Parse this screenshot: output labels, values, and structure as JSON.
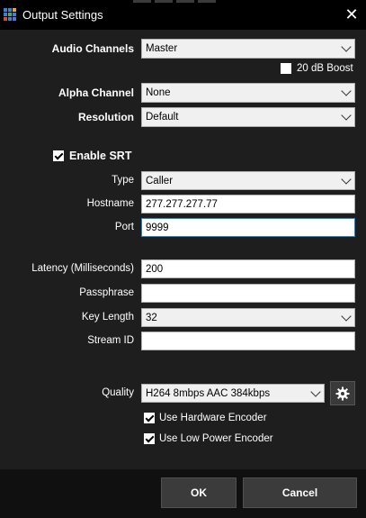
{
  "window": {
    "title": "Output Settings"
  },
  "audio": {
    "label": "Audio Channels",
    "value": "Master",
    "boost_label": "20 dB Boost",
    "boost_checked": false
  },
  "alpha": {
    "label": "Alpha Channel",
    "value": "None"
  },
  "resolution": {
    "label": "Resolution",
    "value": "Default"
  },
  "srt": {
    "enable_label": "Enable SRT",
    "enabled": true,
    "type_label": "Type",
    "type_value": "Caller",
    "hostname_label": "Hostname",
    "hostname_value": "277.277.277.77",
    "port_label": "Port",
    "port_value": "9999",
    "latency_label": "Latency (Milliseconds)",
    "latency_value": "200",
    "passphrase_label": "Passphrase",
    "passphrase_value": "",
    "keylength_label": "Key Length",
    "keylength_value": "32",
    "streamid_label": "Stream ID",
    "streamid_value": ""
  },
  "quality": {
    "label": "Quality",
    "value": "H264 8mbps AAC 384kbps",
    "hw_encoder_label": "Use Hardware Encoder",
    "hw_encoder_checked": true,
    "low_power_label": "Use Low Power Encoder",
    "low_power_checked": true
  },
  "buttons": {
    "ok": "OK",
    "cancel": "Cancel"
  },
  "colors": {
    "focus_border": "#1f8bd3",
    "app_icon": [
      "#3d7fd9",
      "#e8a33a",
      "#4caf50",
      "#d94b3d"
    ]
  }
}
